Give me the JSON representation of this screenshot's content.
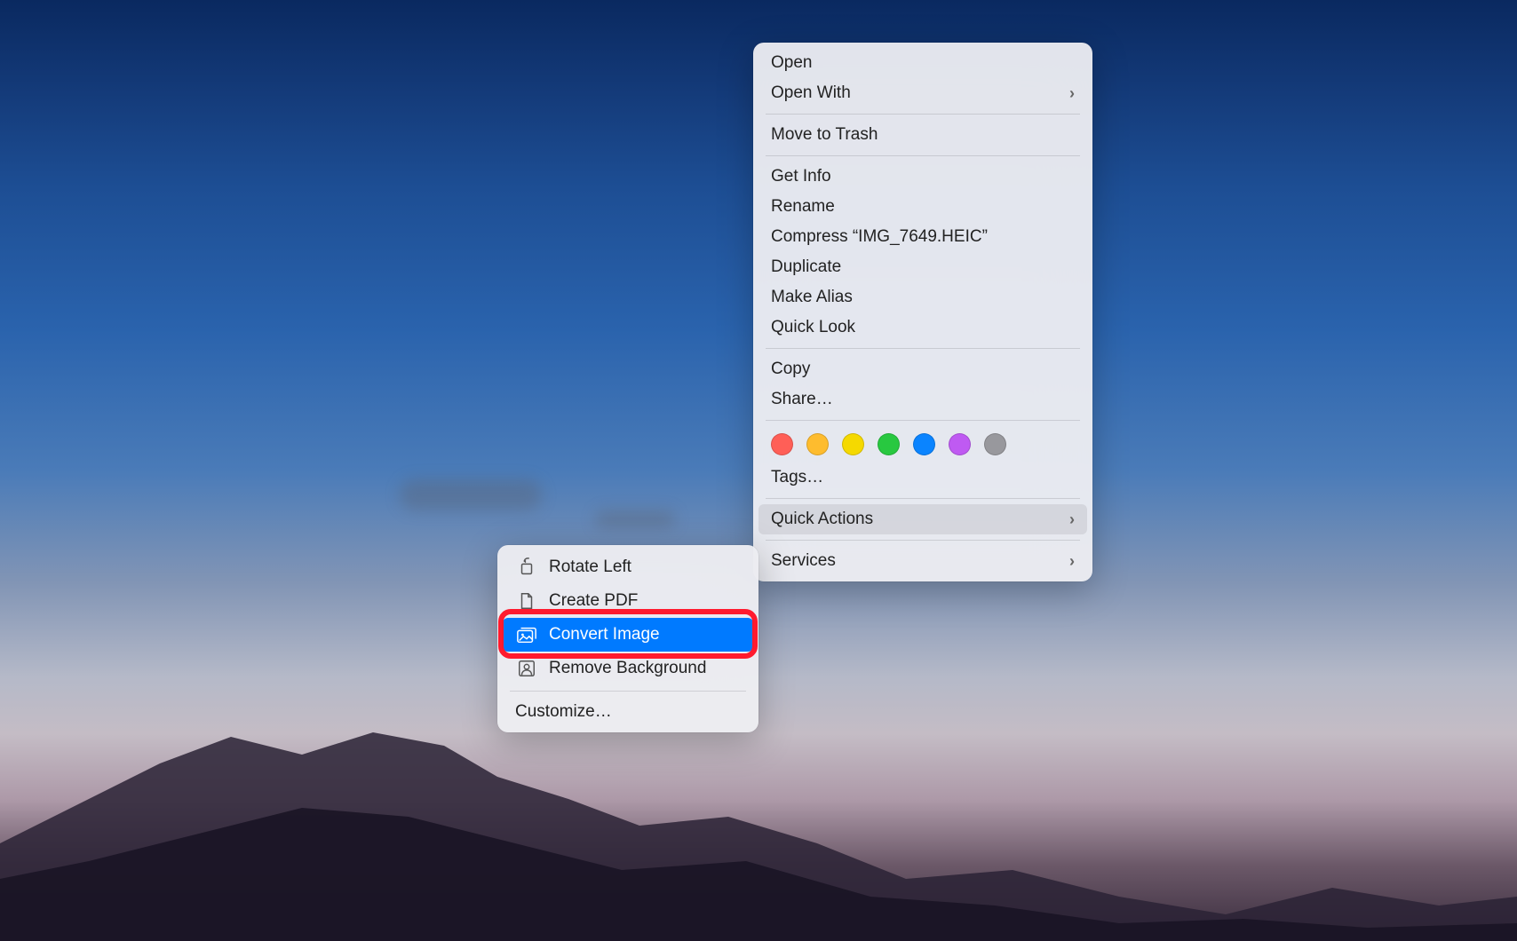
{
  "context_menu": {
    "groups": [
      [
        {
          "label": "Open",
          "id": "open"
        },
        {
          "label": "Open With",
          "id": "open-with",
          "submenu": true
        }
      ],
      [
        {
          "label": "Move to Trash",
          "id": "move-to-trash"
        }
      ],
      [
        {
          "label": "Get Info",
          "id": "get-info"
        },
        {
          "label": "Rename",
          "id": "rename"
        },
        {
          "label": "Compress “IMG_7649.HEIC”",
          "id": "compress"
        },
        {
          "label": "Duplicate",
          "id": "duplicate"
        },
        {
          "label": "Make Alias",
          "id": "make-alias"
        },
        {
          "label": "Quick Look",
          "id": "quick-look"
        }
      ],
      [
        {
          "label": "Copy",
          "id": "copy"
        },
        {
          "label": "Share…",
          "id": "share"
        }
      ]
    ],
    "tags": {
      "label": "Tags…",
      "colors": [
        "#ff5f57",
        "#febc2e",
        "#f5d900",
        "#28c840",
        "#0a84ff",
        "#bf5af2",
        "#98989d"
      ]
    },
    "bottom_group": [
      {
        "label": "Quick Actions",
        "id": "quick-actions",
        "submenu": true,
        "active": true
      },
      {
        "label": "Services",
        "id": "services",
        "submenu": true
      }
    ]
  },
  "quick_actions_submenu": {
    "items": [
      {
        "label": "Rotate Left",
        "id": "rotate-left",
        "icon": "rotate"
      },
      {
        "label": "Create PDF",
        "id": "create-pdf",
        "icon": "document"
      },
      {
        "label": "Convert Image",
        "id": "convert-image",
        "icon": "images",
        "highlighted": true
      },
      {
        "label": "Remove Background",
        "id": "remove-background",
        "icon": "person-crop"
      }
    ],
    "customize": {
      "label": "Customize…",
      "id": "customize"
    }
  }
}
